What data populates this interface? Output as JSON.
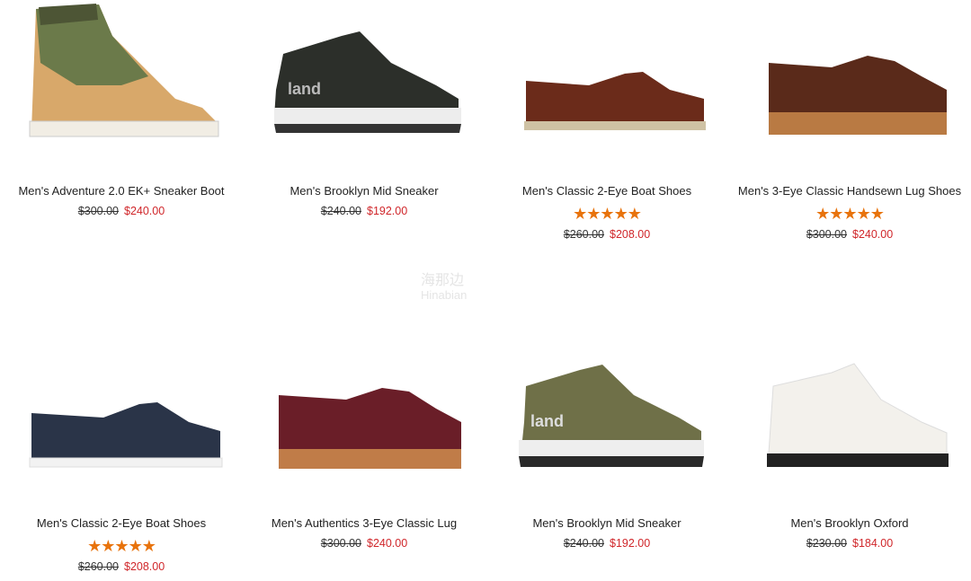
{
  "products": [
    {
      "name": "Men's Adventure 2.0 EK+ Sneaker Boot",
      "old_price": "$300.00",
      "sale_price": "$240.00",
      "rating_stars": ""
    },
    {
      "name": "Men's Brooklyn Mid Sneaker",
      "old_price": "$240.00",
      "sale_price": "$192.00",
      "rating_stars": ""
    },
    {
      "name": "Men's Classic 2-Eye Boat Shoes",
      "old_price": "$260.00",
      "sale_price": "$208.00",
      "rating_stars": "★★★★★"
    },
    {
      "name": "Men's 3-Eye Classic Handsewn Lug Shoes",
      "old_price": "$300.00",
      "sale_price": "$240.00",
      "rating_stars": "★★★★★"
    },
    {
      "name": "Men's Classic 2-Eye Boat Shoes",
      "old_price": "$260.00",
      "sale_price": "$208.00",
      "rating_stars": "★★★★★"
    },
    {
      "name": "Men's Authentics 3-Eye Classic Lug",
      "old_price": "$300.00",
      "sale_price": "$240.00",
      "rating_stars": ""
    },
    {
      "name": "Men's Brooklyn Mid Sneaker",
      "old_price": "$240.00",
      "sale_price": "$192.00",
      "rating_stars": ""
    },
    {
      "name": "Men's Brooklyn Oxford",
      "old_price": "$230.00",
      "sale_price": "$184.00",
      "rating_stars": ""
    }
  ],
  "watermark": {
    "line1": "海那边",
    "line2": "Hinabian"
  },
  "colors": {
    "sale_price": "#d0262a",
    "stars": "#e8730c"
  }
}
